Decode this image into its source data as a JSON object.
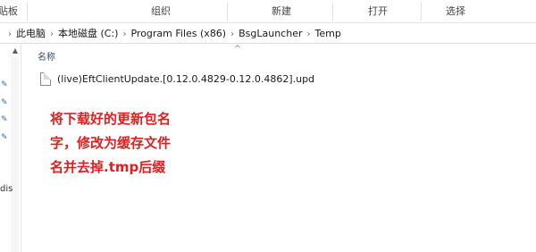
{
  "ribbon": {
    "groups": [
      "贴板",
      "组织",
      "新建",
      "打开",
      "选择"
    ]
  },
  "address": {
    "crumbs": [
      "此电脑",
      "本地磁盘 (C:)",
      "Program Files (x86)",
      "BsgLauncher",
      "Temp"
    ]
  },
  "nav": {
    "partial_label": "dis"
  },
  "columns": {
    "name": "名称"
  },
  "files": [
    {
      "name": "(live)EftClientUpdate.[0.12.0.4829-0.12.0.4862].upd",
      "icon": "file-icon"
    }
  ],
  "annotation": {
    "lines": [
      "将下载好的更新包名",
      "字，修改为缓存文件",
      "名并去掉.tmp后缀"
    ],
    "color": "#e02020"
  }
}
